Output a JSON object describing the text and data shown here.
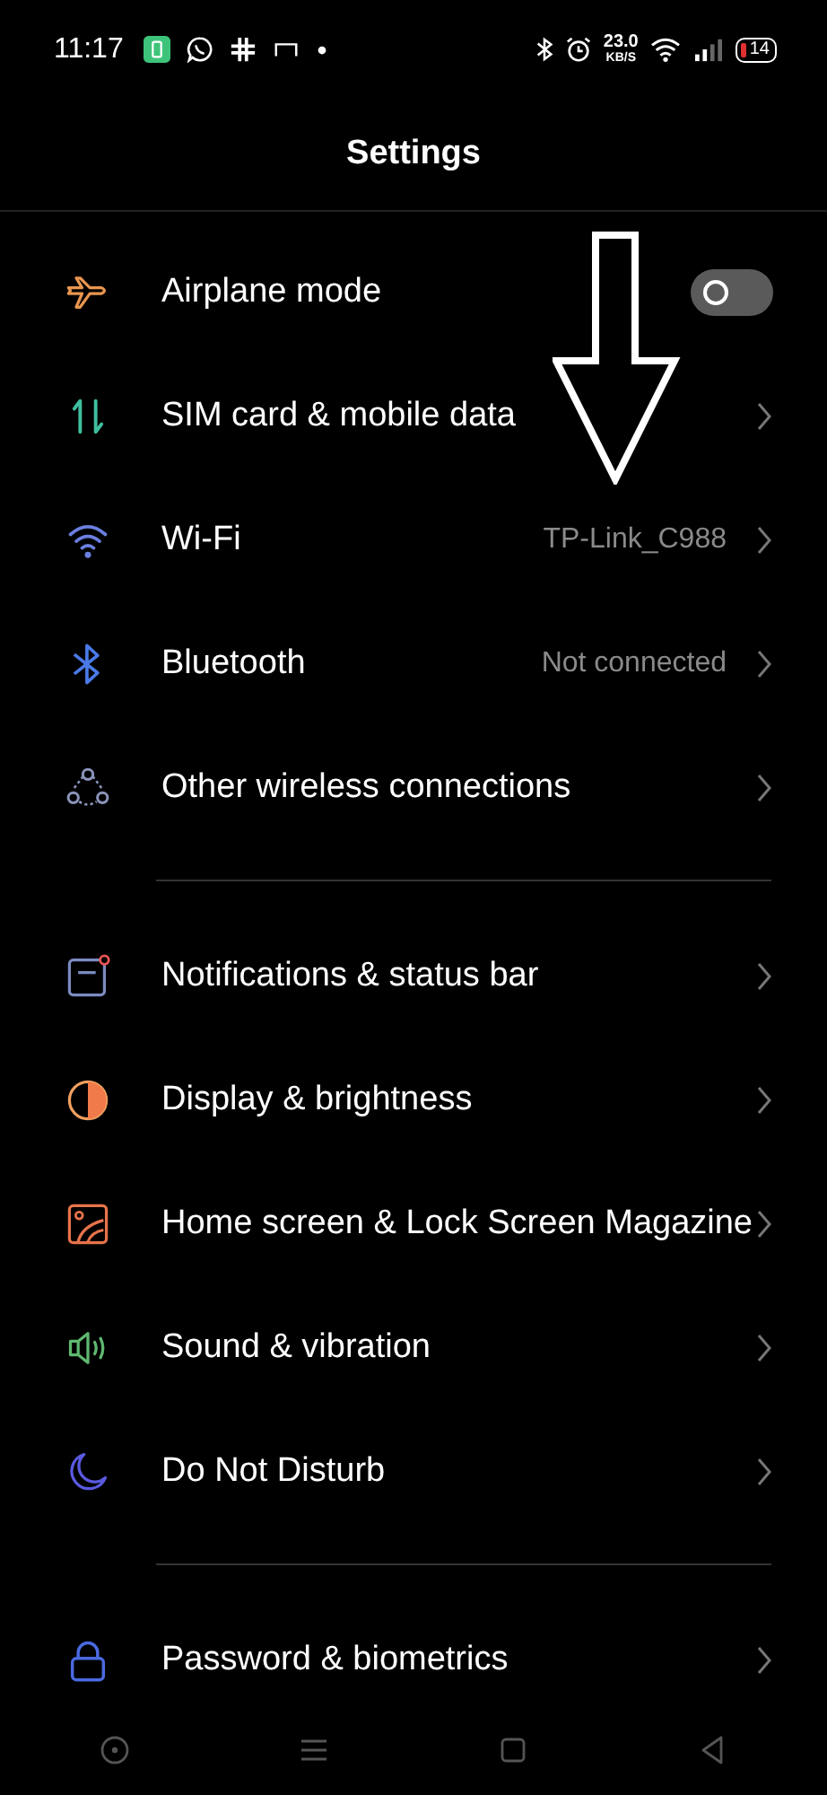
{
  "status_bar": {
    "time": "11:17",
    "speed": "23.0",
    "speed_unit": "KB/S",
    "battery": "14"
  },
  "title": "Settings",
  "groups": [
    {
      "rows": [
        {
          "kind": "toggle",
          "label": "Airplane mode",
          "on": false
        },
        {
          "kind": "link",
          "label": "SIM card & mobile data"
        },
        {
          "kind": "link",
          "label": "Wi-Fi",
          "value": "TP-Link_C988"
        },
        {
          "kind": "link",
          "label": "Bluetooth",
          "value": "Not connected"
        },
        {
          "kind": "link",
          "label": "Other wireless connections"
        }
      ]
    },
    {
      "rows": [
        {
          "kind": "link",
          "label": "Notifications & status bar"
        },
        {
          "kind": "link",
          "label": "Display & brightness"
        },
        {
          "kind": "link",
          "label": "Home screen & Lock Screen Magazine"
        },
        {
          "kind": "link",
          "label": "Sound & vibration"
        },
        {
          "kind": "link",
          "label": "Do Not Disturb"
        }
      ]
    },
    {
      "rows": [
        {
          "kind": "link",
          "label": "Password & biometrics"
        }
      ]
    }
  ]
}
